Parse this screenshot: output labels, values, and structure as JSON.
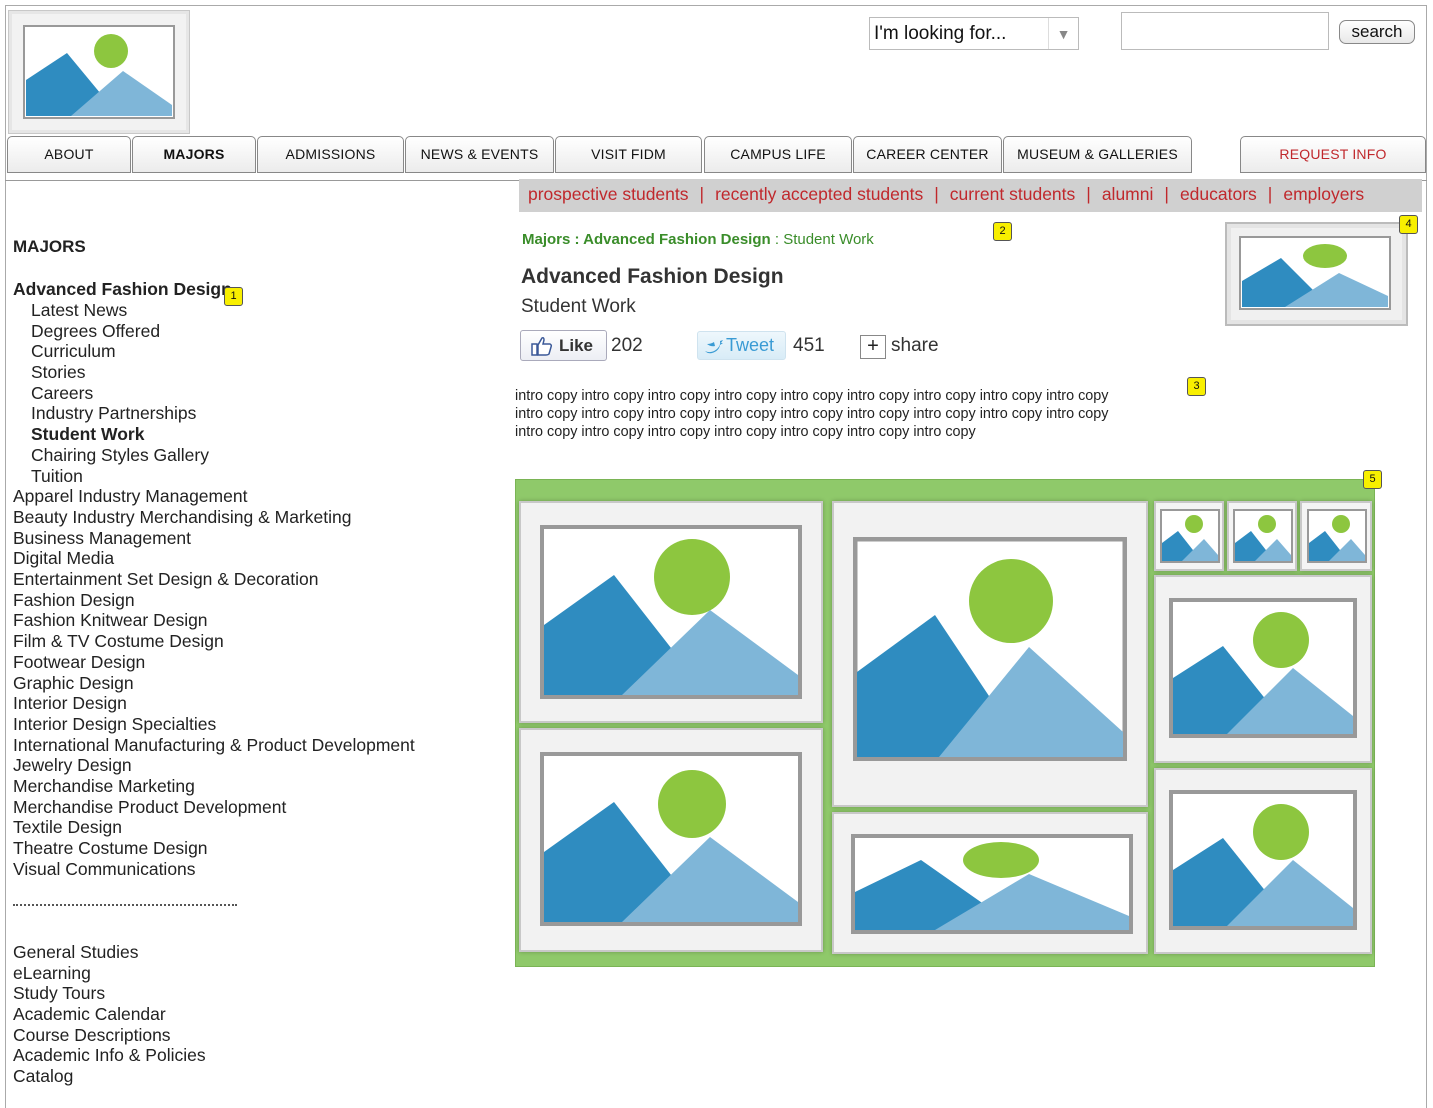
{
  "header": {
    "logo_icon": "image-placeholder-icon",
    "looking_for": "I'm looking for...",
    "search_value": "",
    "search_label": "search"
  },
  "nav": {
    "tabs": [
      {
        "label": "ABOUT",
        "active": false
      },
      {
        "label": "MAJORS",
        "active": true
      },
      {
        "label": "ADMISSIONS",
        "active": false
      },
      {
        "label": "NEWS & EVENTS",
        "active": false
      },
      {
        "label": "VISIT FIDM",
        "active": false
      },
      {
        "label": "CAMPUS LIFE",
        "active": false
      },
      {
        "label": "CAREER CENTER",
        "active": false
      },
      {
        "label": "MUSEUM & GALLERIES",
        "active": false
      }
    ],
    "request_info": "REQUEST INFO"
  },
  "audience": [
    "prospective students",
    "recently accepted students",
    "current students",
    "alumni",
    "educators",
    "employers"
  ],
  "sidebar": {
    "heading": "MAJORS",
    "current_major": "Advanced Fashion Design",
    "sub_items": [
      "Latest News",
      "Degrees Offered",
      "Curriculum",
      "Stories",
      "Careers",
      "Industry Partnerships",
      "Student Work",
      "Chairing Styles Gallery",
      "Tuition"
    ],
    "active_sub": "Student Work",
    "majors": [
      "Apparel Industry Management",
      "Beauty Industry Merchandising & Marketing",
      "Business Management",
      "Digital Media",
      "Entertainment Set Design & Decoration",
      "Fashion Design",
      "Fashion Knitwear Design",
      "Film & TV Costume Design",
      "Footwear Design",
      "Graphic Design",
      "Interior Design",
      "Interior Design Specialties",
      "International Manufacturing & Product Development",
      "Jewelry Design",
      "Merchandise Marketing",
      "Merchandise Product Development",
      "Textile Design",
      "Theatre Costume Design",
      "Visual Communications"
    ],
    "other_links": [
      "General Studies",
      "eLearning",
      "Study Tours",
      "Academic Calendar",
      "Course Descriptions",
      "Academic Info & Policies",
      "Catalog"
    ]
  },
  "content": {
    "breadcrumb_1": "Majors",
    "breadcrumb_sep": " : ",
    "breadcrumb_2": "Advanced Fashion Design",
    "breadcrumb_3": "Student Work",
    "title": "Advanced Fashion Design",
    "subtitle": "Student Work",
    "like_label": "Like",
    "like_count": "202",
    "tweet_label": "Tweet",
    "tweet_count": "451",
    "share_plus": "+",
    "share_label": "share",
    "intro_lines": [
      "intro copy intro copy intro copy intro copy intro copy intro copy intro copy intro copy intro copy",
      "intro copy intro copy intro copy intro copy intro copy intro copy intro copy intro copy intro copy",
      "intro copy intro copy intro copy intro copy intro copy intro copy intro copy"
    ]
  },
  "annotations": [
    "1",
    "2",
    "3",
    "4",
    "5"
  ],
  "colors": {
    "accent_red": "#c0282c",
    "breadcrumb_green": "#3a8d2a",
    "gallery_green": "#8fc96a",
    "annotation_yellow": "#f8ef00"
  }
}
